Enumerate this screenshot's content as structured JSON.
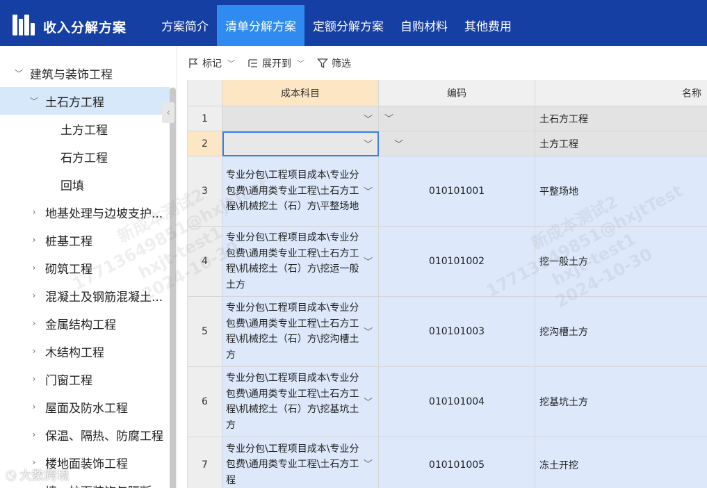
{
  "header": {
    "app_title": "收入分解方案",
    "nav": [
      {
        "label": "方案简介",
        "active": false
      },
      {
        "label": "清单分解方案",
        "active": true
      },
      {
        "label": "定额分解方案",
        "active": false
      },
      {
        "label": "自购材料",
        "active": false
      },
      {
        "label": "其他费用",
        "active": false
      }
    ],
    "colors": {
      "header_bg": "#163fa3",
      "active_tab": "#2f8bf0"
    }
  },
  "sidebar": {
    "collapse_icon": "chevron-left-icon",
    "items": [
      {
        "label": "建筑与装饰工程",
        "expanded": true
      },
      {
        "label": "土石方工程",
        "expanded": true,
        "selected": true
      },
      {
        "label": "土方工程"
      },
      {
        "label": "石方工程"
      },
      {
        "label": "回填"
      },
      {
        "label": "地基处理与边坡支护..."
      },
      {
        "label": "桩基工程"
      },
      {
        "label": "砌筑工程"
      },
      {
        "label": "混凝土及钢筋混凝土..."
      },
      {
        "label": "金属结构工程"
      },
      {
        "label": "木结构工程"
      },
      {
        "label": "门窗工程"
      },
      {
        "label": "屋面及防水工程"
      },
      {
        "label": "保温、隔热、防腐工程"
      },
      {
        "label": "楼地面装饰工程"
      },
      {
        "label": "墙、柱面装饰与隔断..."
      }
    ]
  },
  "toolbar": {
    "mark": "标记",
    "expand_to": "展开到",
    "filter": "筛选"
  },
  "grid": {
    "headers": {
      "num": "",
      "cost": "成本科目",
      "code": "编码",
      "name": "名称"
    },
    "rows": [
      {
        "num": "1",
        "cost": "",
        "code": "",
        "name": "土石方工程"
      },
      {
        "num": "2",
        "cost": "",
        "code": "",
        "name": "土方工程"
      },
      {
        "num": "3",
        "cost": "专业分包\\工程项目成本\\专业分包费\\通用类专业工程\\土石方工程\\机械挖土（石）方\\平整场地",
        "code": "010101001",
        "name": "平整场地"
      },
      {
        "num": "4",
        "cost": "专业分包\\工程项目成本\\专业分包费\\通用类专业工程\\土石方工程\\机械挖土（石）方\\挖运一般土方",
        "code": "010101002",
        "name": "挖一般土方"
      },
      {
        "num": "5",
        "cost": "专业分包\\工程项目成本\\专业分包费\\通用类专业工程\\土石方工程\\机械挖土（石）方\\挖沟槽土方",
        "code": "010101003",
        "name": "挖沟槽土方"
      },
      {
        "num": "6",
        "cost": "专业分包\\工程项目成本\\专业分包费\\通用类专业工程\\土石方工程\\机械挖土（石）方\\挖基坑土方",
        "code": "010101004",
        "name": "挖基坑土方"
      },
      {
        "num": "7",
        "cost": "专业分包\\工程项目成本\\专业分包费\\通用类专业工程\\土石方工程",
        "code": "010101005",
        "name": "冻土开挖"
      }
    ]
  },
  "watermark": {
    "lines": [
      "新成本测试2",
      "17713649851@hxjtTest",
      "hxjt-test1",
      "2024-10-30"
    ]
  },
  "footer_logo": "大数跨境"
}
